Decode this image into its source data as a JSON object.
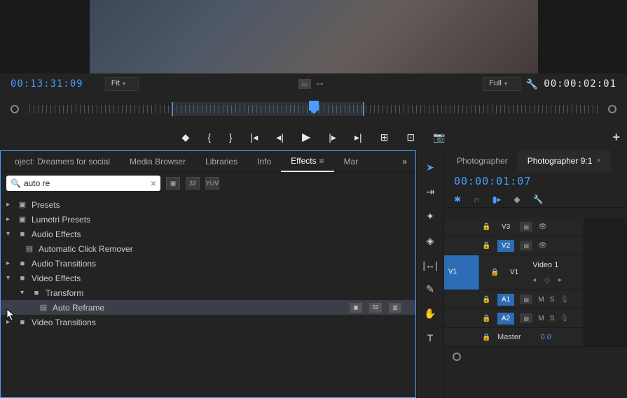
{
  "source_timecode": "00:13:31:09",
  "program_timecode": "00:00:02:01",
  "zoom_fit": "Fit",
  "quality_full": "Full",
  "panel": {
    "project_tab": "oject: Dreamers for social",
    "media_browser": "Media Browser",
    "libraries": "Libraries",
    "info": "Info",
    "effects": "Effects",
    "markers": "Mar"
  },
  "search": {
    "value": "auto re",
    "badge_32": "32",
    "badge_yuv": "YUV"
  },
  "tree": {
    "presets": "Presets",
    "lumetri": "Lumetri Presets",
    "audio_fx": "Audio Effects",
    "auto_click": "Automatic Click Remover",
    "audio_trans": "Audio Transitions",
    "video_fx": "Video Effects",
    "transform": "Transform",
    "auto_reframe": "Auto Reframe",
    "video_trans": "Video Transitions"
  },
  "timeline": {
    "tab1": "Photographer",
    "tab2": "Photographer 9:1",
    "timecode": "00:00:01:07",
    "v3": "V3",
    "v2": "V2",
    "v1_src": "V1",
    "v1": "V1",
    "video1_clip": "Video 1",
    "a1": "A1",
    "a2": "A2",
    "m": "M",
    "s": "S",
    "master": "Master",
    "master_val": "0.0"
  }
}
